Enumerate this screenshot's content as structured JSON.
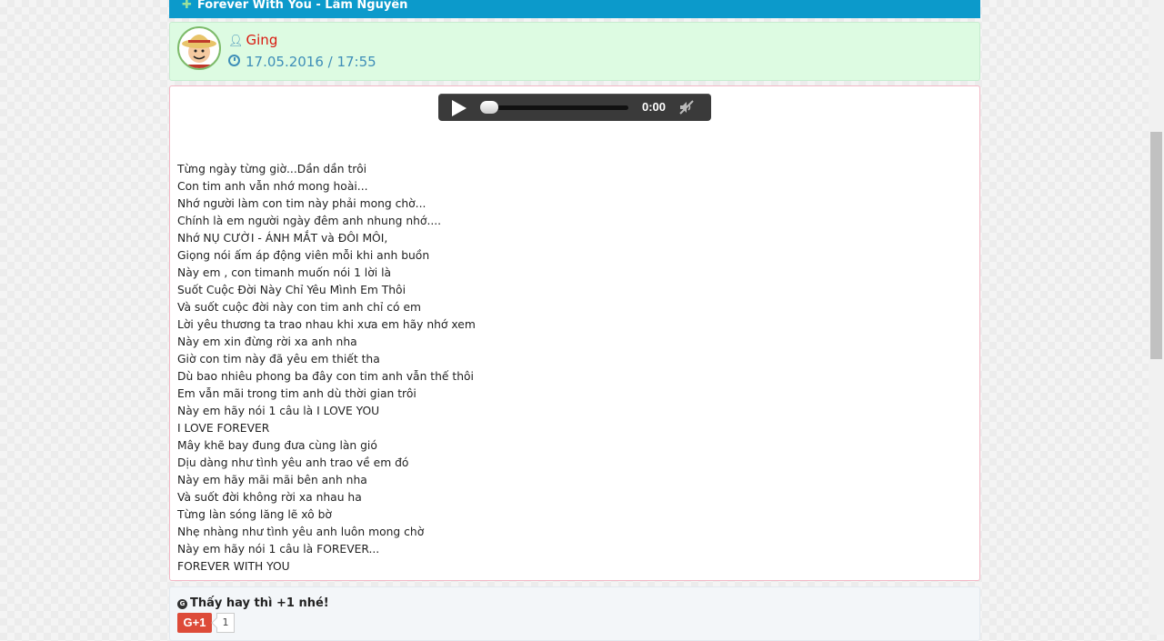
{
  "post": {
    "title": "Forever With You - Lâm Nguyên",
    "title_icon": "plus-icon"
  },
  "author": {
    "name": "Ging",
    "date": "17.05.2016 / 17:55",
    "avatar": "avatar",
    "user_icon": "user-icon",
    "clock_icon": "clock-icon"
  },
  "player": {
    "time": "0:00",
    "progress": 0,
    "muted": true
  },
  "lyrics": [
    "Từng ngày từng giờ...Dần dần trôi",
    "Con tim anh vẫn nhớ mong hoài...",
    "Nhớ người làm con tim này phải mong chờ...",
    "Chính là em người ngày đêm anh nhung nhớ....",
    "Nhớ NỤ CƯỜI - ÁNH MẮT và ĐÔI MÔI,",
    "Giọng nói ấm áp động viên mỗi khi anh buồn",
    "Này em , con timanh muốn nói 1 lời là",
    "Suốt Cuộc Đời Này Chỉ Yêu Mình Em Thôi",
    "Và suốt cuộc đời này con tim anh chỉ có em",
    "Lời yêu thương ta trao nhau khi xưa em hãy nhớ xem",
    "Này em xin đừng rời xa anh nha",
    "Giờ con tim này đã yêu em thiết tha",
    "Dù bao nhiêu phong ba đây con tim anh vẫn thế thôi",
    "Em vẫn mãi trong tim anh dù thời gian trôi",
    "Này em hãy nói 1 câu là I LOVE YOU",
    "I LOVE FOREVER",
    "Mây khẽ bay đung đưa cùng làn gió",
    "Dịu dàng như tình yêu anh trao về em đó",
    "Này em hãy mãi mãi bên anh nha",
    "Và suốt đời không rời xa nhau ha",
    "Từng làn sóng lăng lẽ xô bờ",
    "Nhẹ nhàng như tình yêu anh luôn mong chờ",
    "Này em hãy nói 1 câu là FOREVER...",
    "FOREVER WITH YOU"
  ],
  "share": {
    "text": "Thấy hay thì +1 nhé!",
    "button_label": "G+1",
    "count": "1"
  },
  "colors": {
    "title_bar": "#0c9acb",
    "author_bg": "#ddfbe2",
    "author_name": "#d9190f",
    "date": "#3e8eb8",
    "gplus": "#dd4b39"
  }
}
